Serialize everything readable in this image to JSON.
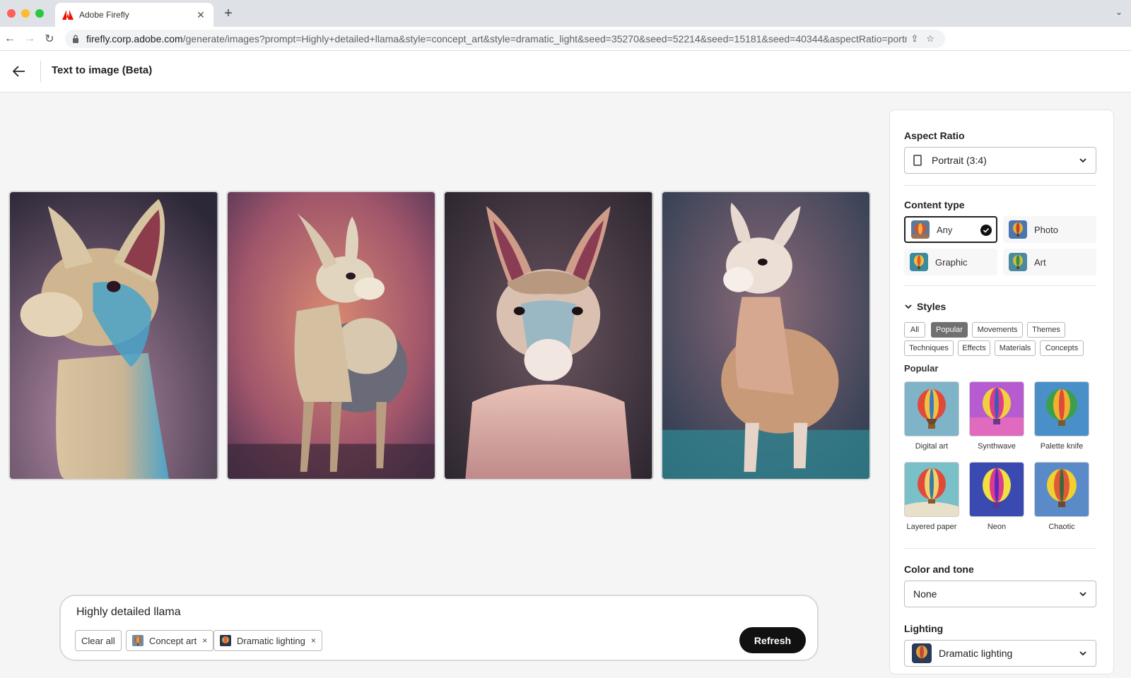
{
  "browser": {
    "tab_title": "Adobe Firefly",
    "url_host": "firefly.corp.adobe.com",
    "url_rest": "/generate/images?prompt=Highly+detailed+llama&style=concept_art&style=dramatic_light&seed=35270&seed=52214&seed=15181&seed=40344&aspectRatio=portrait..."
  },
  "header": {
    "title": "Text to image (Beta)"
  },
  "gallery": {
    "images": [
      {
        "name": "llama-1",
        "bg": "#4a3a55"
      },
      {
        "name": "llama-2",
        "bg": "#a0566a"
      },
      {
        "name": "llama-3",
        "bg": "#3a3440"
      },
      {
        "name": "llama-4",
        "bg": "#3f4a5c"
      }
    ]
  },
  "prompt": {
    "text": "Highly detailed llama",
    "clear_all": "Clear all",
    "chips": [
      {
        "label": "Concept art",
        "remove": "×"
      },
      {
        "label": "Dramatic lighting",
        "remove": "×"
      }
    ],
    "refresh": "Refresh"
  },
  "panel": {
    "aspect_ratio": {
      "title": "Aspect Ratio",
      "value": "Portrait (3:4)"
    },
    "content_type": {
      "title": "Content type",
      "options": [
        "Any",
        "Photo",
        "Graphic",
        "Art"
      ],
      "selected": "Any"
    },
    "styles": {
      "title": "Styles",
      "filters": [
        "All",
        "Popular",
        "Movements",
        "Themes",
        "Techniques",
        "Effects",
        "Materials",
        "Concepts"
      ],
      "active_filter": "Popular",
      "section_title": "Popular",
      "items": [
        "Digital art",
        "Synthwave",
        "Palette knife",
        "Layered paper",
        "Neon",
        "Chaotic"
      ]
    },
    "color_tone": {
      "title": "Color and tone",
      "value": "None"
    },
    "lighting": {
      "title": "Lighting",
      "value": "Dramatic lighting"
    }
  },
  "colors": {
    "accent_dark": "#111111",
    "selected_pill": "#707070",
    "adobe_red": "#eb1000"
  }
}
